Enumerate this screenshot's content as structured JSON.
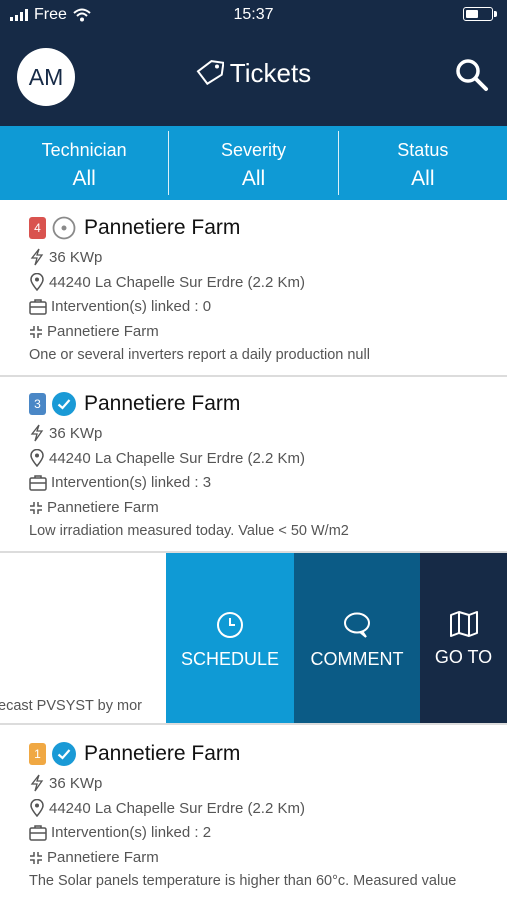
{
  "status_bar": {
    "carrier": "Free",
    "time": "15:37",
    "battery_level": 0.5
  },
  "header": {
    "avatar_initials": "AM",
    "title": "Tickets"
  },
  "filters": [
    {
      "label": "Technician",
      "value": "All"
    },
    {
      "label": "Severity",
      "value": "All"
    },
    {
      "label": "Status",
      "value": "All"
    }
  ],
  "tickets": [
    {
      "severity": "4",
      "severity_color": "#d9534f",
      "status_icon": "open-circle-icon",
      "name": "Pannetiere Farm",
      "power": "36 KWp",
      "address": "44240 La Chapelle Sur Erdre (2.2 Km)",
      "interventions": "Intervention(s) linked : 0",
      "site": "Pannetiere Farm",
      "description": "One or several inverters report a daily production null"
    },
    {
      "severity": "3",
      "severity_color": "#4a87c6",
      "status_icon": "check-circle-icon",
      "name": "Pannetiere Farm",
      "power": "36 KWp",
      "address": "44240 La Chapelle Sur Erdre (2.2 Km)",
      "interventions": "Intervention(s) linked : 3",
      "site": "Pannetiere Farm",
      "description": "Low irradiation measured today.  Value < 50 W/m2"
    },
    {
      "severity": "1",
      "severity_color": "#f0a843",
      "status_icon": "check-circle-icon",
      "name": "Pannetiere Farm",
      "power": "36 KWp",
      "address": "44240 La Chapelle Sur Erdre (2.2 Km)",
      "interventions": "Intervention(s) linked : 2",
      "site": "Pannetiere Farm",
      "description": "The Solar panels temperature is higher than 60°c.  Measured value"
    }
  ],
  "swiped_row": {
    "peek_text": "ecast PVSYST by mor",
    "actions": {
      "schedule": "SCHEDULE",
      "comment": "COMMENT",
      "goto": "GO TO"
    }
  },
  "colors": {
    "header": "#162a46",
    "accent": "#0f9ad5",
    "comment": "#0b5b86",
    "check": "#1a9ad6"
  }
}
